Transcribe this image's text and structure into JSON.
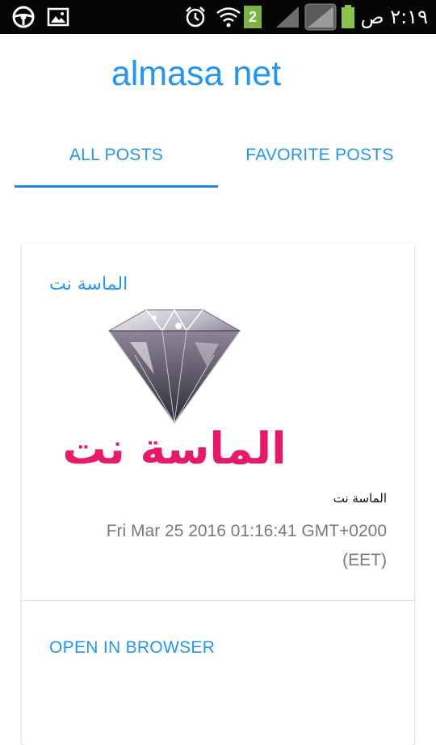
{
  "status_bar": {
    "time": "٢:١٩ ص",
    "sim_badge": "2",
    "icons": [
      "steering-wheel-icon",
      "image-icon",
      "alarm-icon",
      "wifi-icon",
      "signal-icon",
      "battery-icon"
    ]
  },
  "app": {
    "title": "almasa net"
  },
  "tabs": {
    "all_posts": "ALL POSTS",
    "favorite_posts": "FAVORITE POSTS",
    "active": "all_posts"
  },
  "post": {
    "title": "الماسة نت",
    "image_text": "الماسة نت",
    "author": "الماسة نت",
    "date": "Fri Mar 25 2016 01:16:41 GMT+0200 (EET)",
    "action_label": "OPEN IN BROWSER"
  },
  "colors": {
    "accent": "#2196f3",
    "indicator": "#1e88e5",
    "image_text": "#e8196a",
    "status_bar": "#050505",
    "battery": "#8bc34a"
  }
}
